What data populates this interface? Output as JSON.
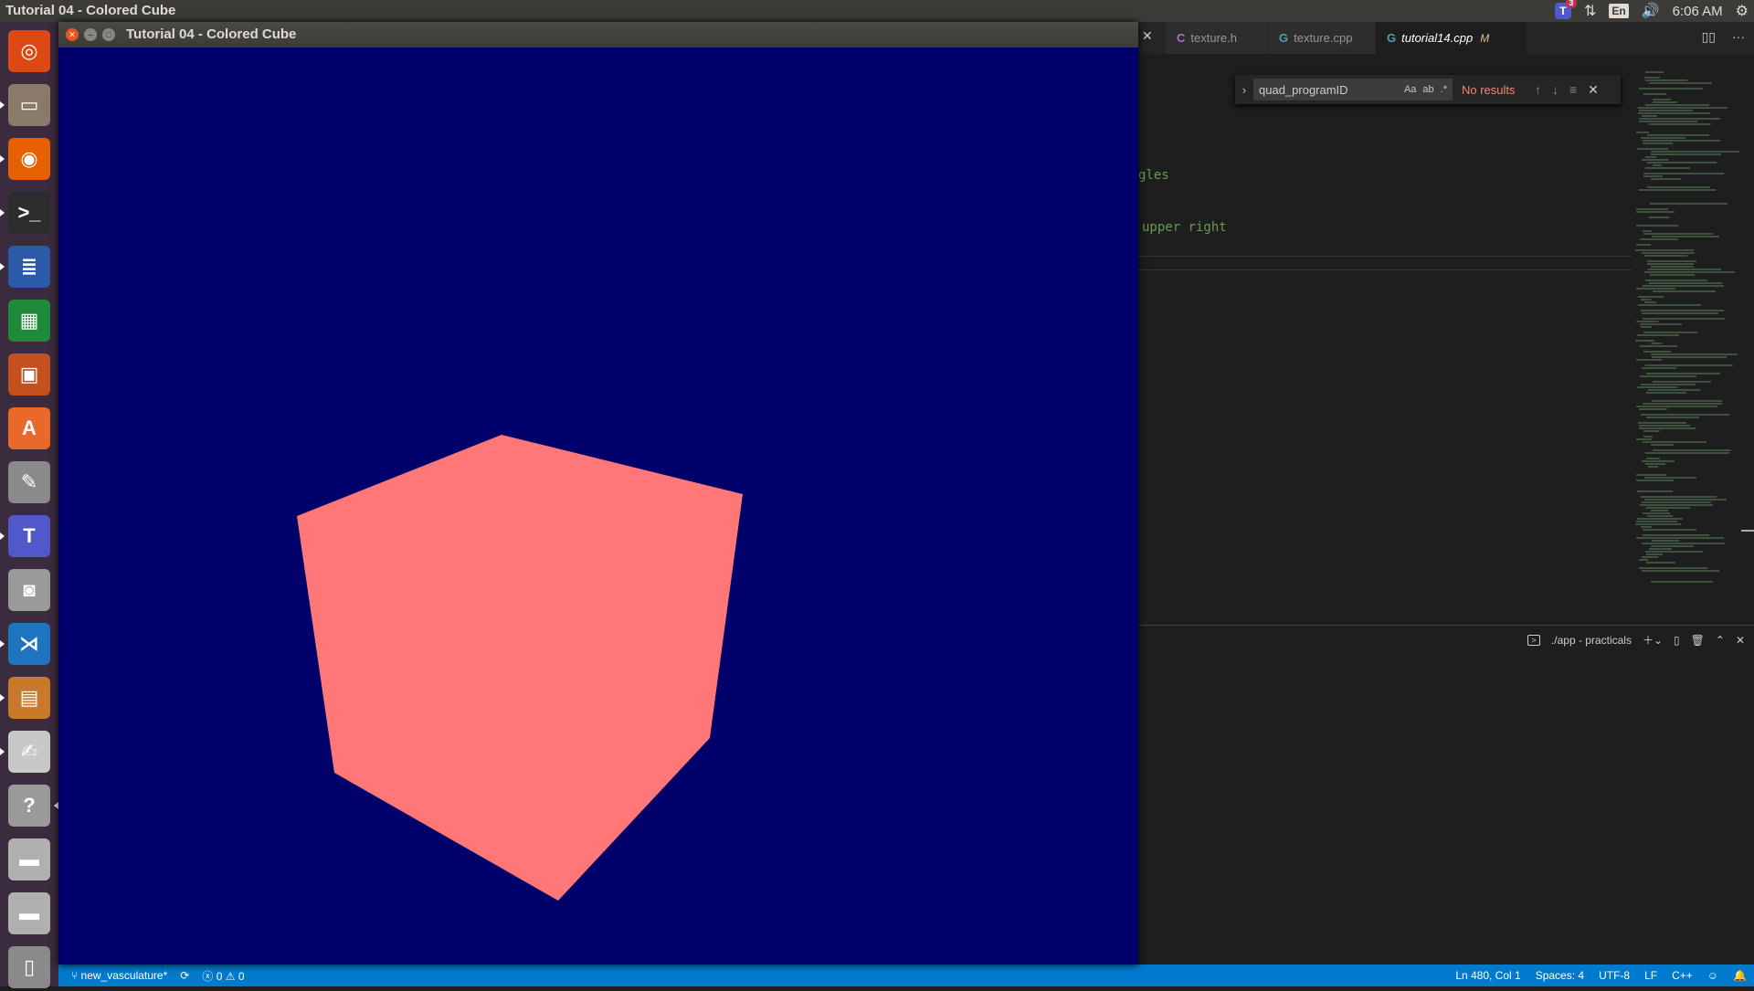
{
  "top_panel": {
    "app_title": "Tutorial 04 - Colored Cube",
    "teams_badge": "3",
    "keyboard_lang": "En",
    "clock": "6:06 AM"
  },
  "launcher": {
    "items": [
      {
        "name": "ubuntu-dash-icon",
        "color": "#dd4814"
      },
      {
        "name": "files-icon",
        "color": "#8a7a6a"
      },
      {
        "name": "firefox-icon",
        "color": "#e66000"
      },
      {
        "name": "terminal-icon",
        "color": "#2c2c2c"
      },
      {
        "name": "libreoffice-writer-icon",
        "color": "#2a5aa8"
      },
      {
        "name": "libreoffice-calc-icon",
        "color": "#1e8a3a"
      },
      {
        "name": "libreoffice-impress-icon",
        "color": "#c4501e"
      },
      {
        "name": "software-center-icon",
        "color": "#e8692a"
      },
      {
        "name": "system-settings-icon",
        "color": "#8a8a8a"
      },
      {
        "name": "teams-icon",
        "color": "#5059c9"
      },
      {
        "name": "screenshot-icon",
        "color": "#9a9a9a"
      },
      {
        "name": "vscode-icon",
        "color": "#1f74c0"
      },
      {
        "name": "archive-manager-icon",
        "color": "#c87a2a"
      },
      {
        "name": "text-editor-icon",
        "color": "#c8c8c8"
      },
      {
        "name": "help-icon",
        "color": "#9a9a9a"
      },
      {
        "name": "drive-icon-1",
        "color": "#b0b0b0"
      },
      {
        "name": "drive-icon-2",
        "color": "#b0b0b0"
      },
      {
        "name": "trash-icon",
        "color": "#8a8a8a"
      }
    ]
  },
  "gl_window": {
    "title": "Tutorial 04 - Colored Cube",
    "background_color": "#00006b",
    "cube_color": "#ff7777"
  },
  "vscode": {
    "tabs": [
      {
        "label": "texture.h",
        "icon": "C"
      },
      {
        "label": "texture.cpp",
        "icon": "G"
      },
      {
        "label": "tutorial14.cpp",
        "icon": "G",
        "modified": "M"
      }
    ],
    "find": {
      "query": "quad_programID",
      "case_label": "Aa",
      "word_label": "ab",
      "regex_label": ".*",
      "result": "No results"
    },
    "code_fragments": [
      "gles",
      "upper right"
    ],
    "terminal": {
      "label": "./app - practicals"
    },
    "status": {
      "branch": "new_vasculature*",
      "errors": "0",
      "warnings": "0",
      "position": "Ln 480, Col 1",
      "spaces": "Spaces: 4",
      "encoding": "UTF-8",
      "eol": "LF",
      "language": "C++"
    }
  }
}
